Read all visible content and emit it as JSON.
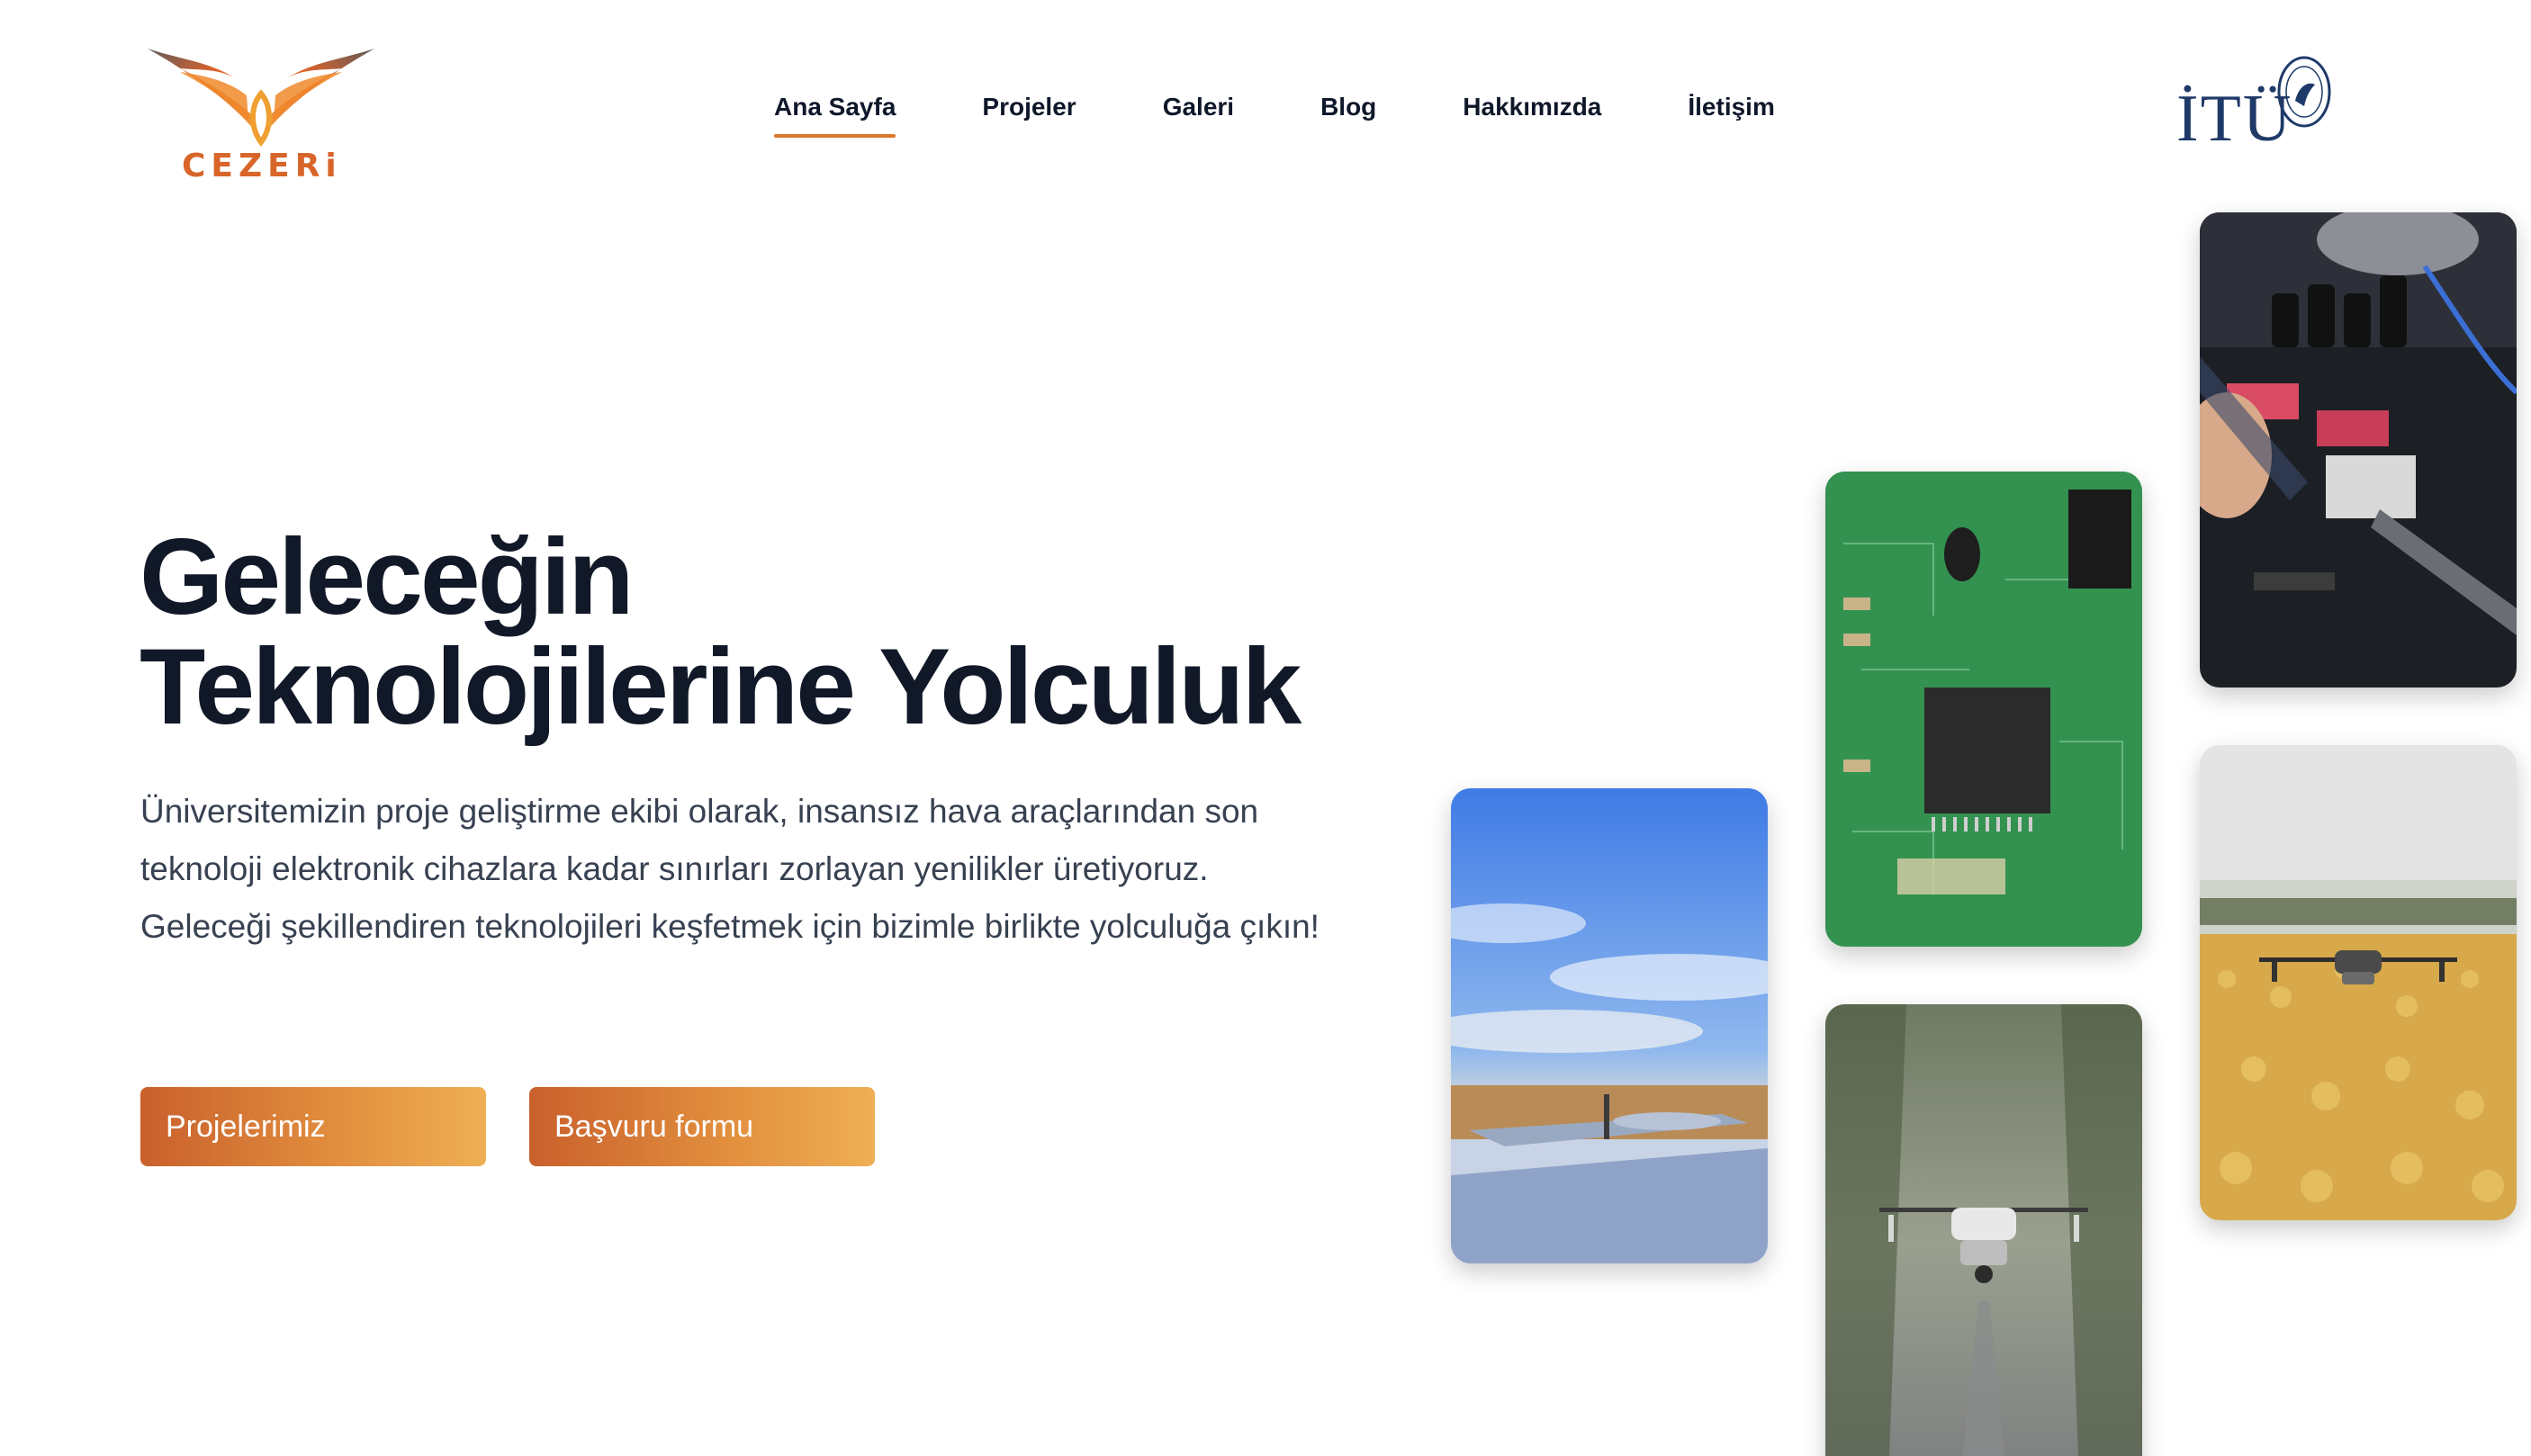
{
  "brand": {
    "logo_text": "CEZERi",
    "university_text": "İTÜ",
    "colors": {
      "accent": "#d9772a",
      "button_start": "#c9602c",
      "button_end": "#eeaf55",
      "university_navy": "#1f3a68"
    }
  },
  "nav": {
    "items": [
      {
        "label": "Ana Sayfa",
        "active": true
      },
      {
        "label": "Projeler",
        "active": false
      },
      {
        "label": "Galeri",
        "active": false
      },
      {
        "label": "Blog",
        "active": false
      },
      {
        "label": "Hakkımızda",
        "active": false
      },
      {
        "label": "İletişim",
        "active": false
      }
    ]
  },
  "hero": {
    "title_line1": "Geleceğin",
    "title_line2": "Teknolojilerine Yolculuk",
    "description": "Üniversitemizin proje geliştirme ekibi olarak, insansız hava araçlarından son teknoloji elektronik cihazlara kadar sınırları zorlayan yenilikler üretiyoruz. Geleceği şekillendiren teknolojileri keşfetmek için bizimle birlikte yolculuğa çıkın!",
    "buttons": {
      "projects": "Projelerimiz",
      "apply": "Başvuru formu"
    }
  },
  "gallery": {
    "images": [
      {
        "name": "fixed-wing-uav-photo"
      },
      {
        "name": "circuit-board-photo"
      },
      {
        "name": "drone-in-fog-photo"
      },
      {
        "name": "soldering-electronics-photo"
      },
      {
        "name": "drone-over-flower-field-photo"
      }
    ]
  }
}
